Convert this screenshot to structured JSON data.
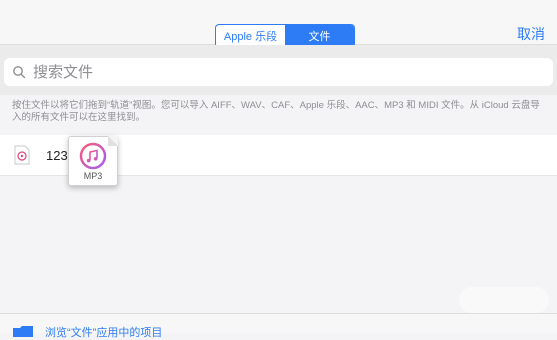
{
  "header": {
    "segments": [
      {
        "label": "Apple 乐段",
        "active": false
      },
      {
        "label": "文件",
        "active": true
      }
    ],
    "cancel_label": "取消"
  },
  "search": {
    "placeholder": "搜索文件",
    "icon": "search-icon"
  },
  "hint": {
    "text": "按住文件以将它们拖到“轨道”视图。您可以导入 AIFF、WAV、CAF、Apple 乐段、AAC、MP3 和 MIDI 文件。从 iCloud 云盘导入的所有文件可以在这里找到。"
  },
  "file_list": [
    {
      "name": "123.",
      "icon": "audio-file-icon"
    }
  ],
  "drag_preview": {
    "label": "MP3",
    "icon": "music-note-icon"
  },
  "footer": {
    "browse_label": "浏览“文件”应用中的项目",
    "icon": "folder-icon"
  },
  "colors": {
    "accent": "#2d7cf6",
    "background": "#f4f4f6",
    "hint_text": "#8e8e93"
  }
}
